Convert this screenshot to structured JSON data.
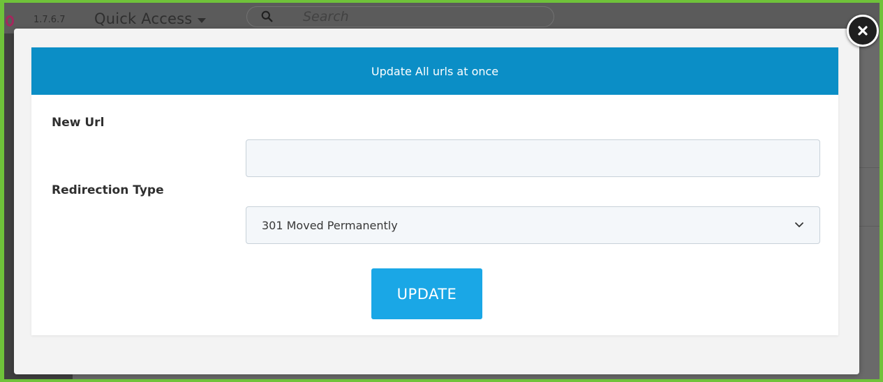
{
  "background": {
    "version": "1.7.6.7",
    "quick_access": "Quick Access",
    "search_placeholder": "Search"
  },
  "modal": {
    "title": "Update All urls at once",
    "new_url": {
      "label": "New Url",
      "value": ""
    },
    "redirection_type": {
      "label": "Redirection Type",
      "selected": "301 Moved Permanently"
    },
    "update_label": "UPDATE"
  },
  "icons": {
    "close": "close-icon",
    "search": "search-icon",
    "dropdown": "chevron-down-icon",
    "menu_caret": "caret-down-icon"
  },
  "colors": {
    "header": "#0b8ec6",
    "button": "#1aa7e6",
    "border": "#6fc23a"
  }
}
